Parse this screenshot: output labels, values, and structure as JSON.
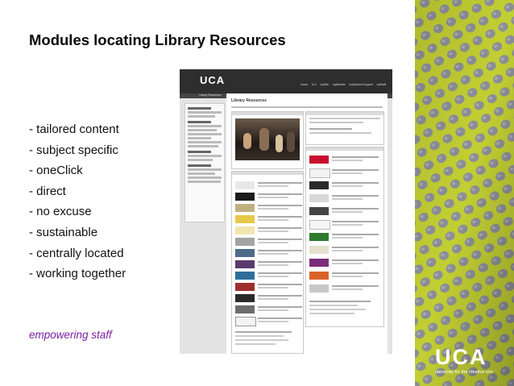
{
  "slide": {
    "title": "Modules locating Library Resources",
    "bullets": [
      "- tailored content",
      "- subject specific",
      "- oneClick",
      "- direct",
      "- no excuse",
      "- sustainable",
      "- centrally located",
      "- working together"
    ],
    "tagline": "empowering staff"
  },
  "screenshot": {
    "app_logo": "UCA",
    "page_title": "Library Resources",
    "nav_items": [
      "Home",
      "A-Z",
      "mySite",
      "myModule",
      "myStudent Support",
      "myStaff"
    ]
  },
  "brand": {
    "logo_text": "UCA",
    "logo_tagline": "university for the creative arts"
  },
  "colors": {
    "tagline": "#7a1fa2",
    "fabric": "#c2cf33",
    "fabric_dots": "#8d8f98"
  }
}
